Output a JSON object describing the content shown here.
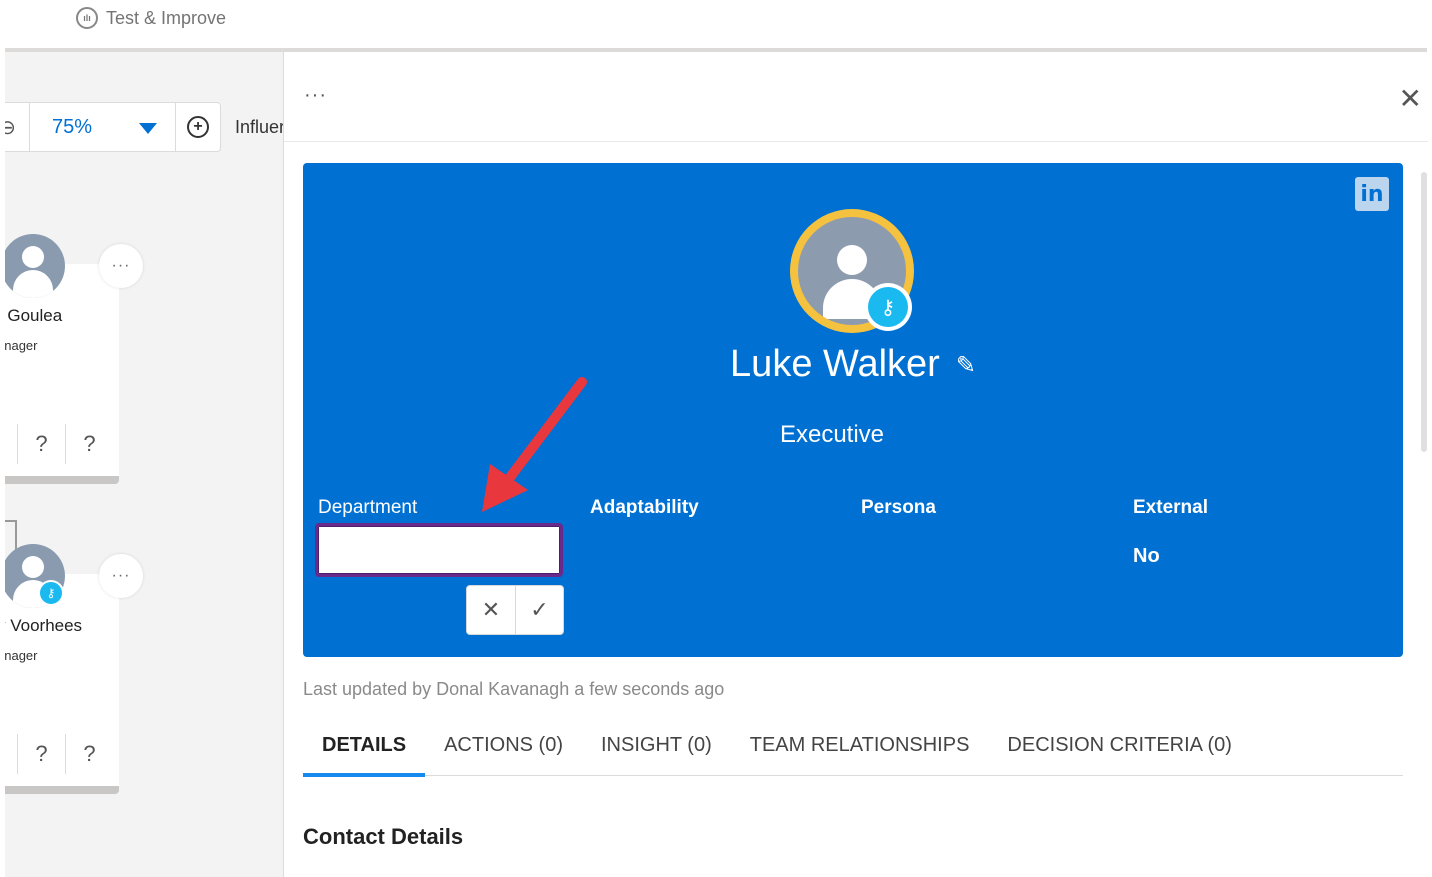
{
  "topbar": {
    "crumb_label": "Test & Improve"
  },
  "canvas": {
    "zoom_value": "75%",
    "influence_label": "Influer",
    "cards": [
      {
        "name": "r Goulea",
        "title": "anager",
        "q1": "?",
        "q2": "?"
      },
      {
        "name": "y Voorhees",
        "title": "anager",
        "q1": "?",
        "q2": "?"
      }
    ],
    "menu_glyph": "···"
  },
  "panel": {
    "menu_glyph": "···",
    "close_glyph": "✕",
    "linkedin_text": "in",
    "contact": {
      "name": "Luke Walker",
      "role": "Executive"
    },
    "fields": {
      "department_label": "Department",
      "department_value": "",
      "adaptability_label": "Adaptability",
      "persona_label": "Persona",
      "external_label": "External",
      "external_value": "No"
    },
    "cancel_glyph": "✕",
    "confirm_glyph": "✓",
    "last_updated": "Last updated by Donal Kavanagh a few seconds ago",
    "tabs": [
      {
        "label": "DETAILS"
      },
      {
        "label": "ACTIONS (0)"
      },
      {
        "label": "INSIGHT (0)"
      },
      {
        "label": "TEAM RELATIONSHIPS"
      },
      {
        "label": "DECISION CRITERIA (0)"
      }
    ],
    "section_title": "Contact Details"
  },
  "colors": {
    "hero_blue": "#0070d2",
    "avatar_ring": "#f4c23e",
    "key_badge": "#1ab9f0",
    "focus_border": "#6a2a8c",
    "arrow_red": "#e8383d",
    "tab_underline": "#1589ee"
  }
}
